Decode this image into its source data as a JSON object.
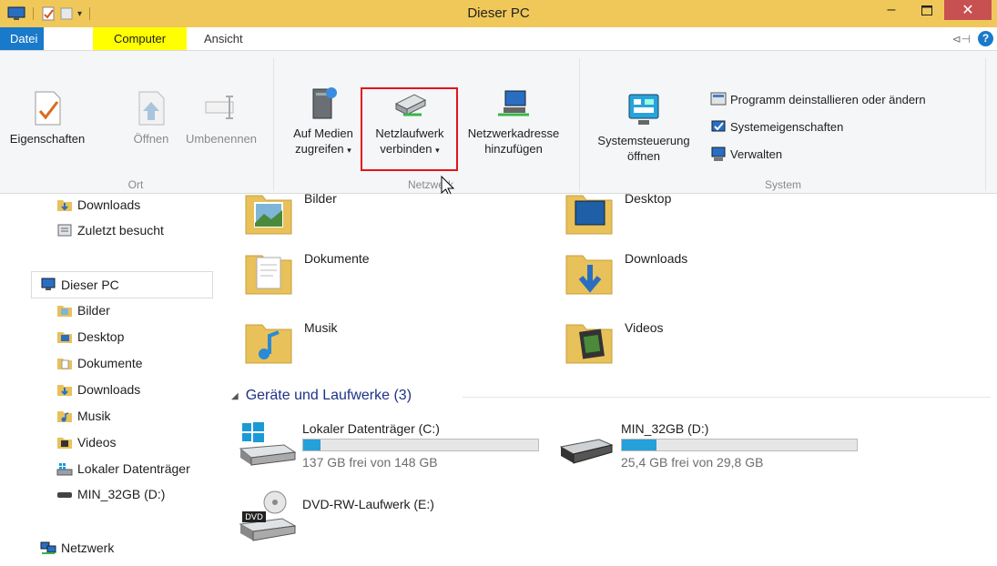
{
  "window": {
    "title": "Dieser PC"
  },
  "tabs": [
    {
      "label": "Datei"
    },
    {
      "label": "Computer"
    },
    {
      "label": "Ansicht"
    }
  ],
  "ribbon": {
    "groups": {
      "ort": {
        "label": "Ort",
        "items": [
          {
            "label": "Eigenschaften",
            "enabled": true,
            "icon": "check-document-icon"
          },
          {
            "label": "Öffnen",
            "enabled": false,
            "icon": "open-icon"
          },
          {
            "label": "Umbenennen",
            "enabled": false,
            "icon": "rename-icon"
          }
        ]
      },
      "netzwerk": {
        "label": "Netzwerk",
        "items": [
          {
            "line1": "Auf Medien",
            "line2": "zugreifen",
            "icon": "media-server-icon"
          },
          {
            "line1": "Netzlaufwerk",
            "line2": "verbinden",
            "icon": "network-drive-icon"
          },
          {
            "line1": "Netzwerkadresse",
            "line2": "hinzufügen",
            "icon": "network-location-icon"
          }
        ]
      },
      "system": {
        "label": "System",
        "control_panel": {
          "line1": "Systemsteuerung",
          "line2": "öffnen"
        },
        "links": [
          {
            "label": "Programm deinstallieren oder ändern",
            "icon": "uninstall-icon"
          },
          {
            "label": "Systemeigenschaften",
            "icon": "system-properties-icon"
          },
          {
            "label": "Verwalten",
            "icon": "manage-icon"
          }
        ]
      }
    },
    "highlight_color": "#e4141b"
  },
  "nav": {
    "items": [
      {
        "label": "Downloads",
        "icon": "downloads-icon"
      },
      {
        "label": "Zuletzt besucht",
        "icon": "recent-icon"
      },
      {
        "label": "Dieser PC",
        "icon": "this-pc-icon"
      },
      {
        "label": "Bilder",
        "icon": "pictures-icon"
      },
      {
        "label": "Desktop",
        "icon": "desktop-icon"
      },
      {
        "label": "Dokumente",
        "icon": "documents-icon"
      },
      {
        "label": "Downloads",
        "icon": "downloads-icon"
      },
      {
        "label": "Musik",
        "icon": "music-icon"
      },
      {
        "label": "Videos",
        "icon": "videos-icon"
      },
      {
        "label": "Lokaler Datenträger",
        "icon": "local-disk-icon"
      },
      {
        "label": "MIN_32GB (D:)",
        "icon": "usb-drive-icon"
      },
      {
        "label": "Netzwerk",
        "icon": "network-icon"
      }
    ]
  },
  "main": {
    "folders": [
      {
        "label": "Bilder"
      },
      {
        "label": "Desktop"
      },
      {
        "label": "Dokumente"
      },
      {
        "label": "Downloads"
      },
      {
        "label": "Musik"
      },
      {
        "label": "Videos"
      }
    ],
    "devices_header": "Geräte und Laufwerke (3)",
    "drives": [
      {
        "name": "Lokaler Datenträger (C:)",
        "free": "137 GB frei von 148 GB",
        "used_fraction": 0.074
      },
      {
        "name": "MIN_32GB (D:)",
        "free": "25,4 GB frei von 29,8 GB",
        "used_fraction": 0.148
      },
      {
        "name": "DVD-RW-Laufwerk (E:)"
      }
    ]
  }
}
